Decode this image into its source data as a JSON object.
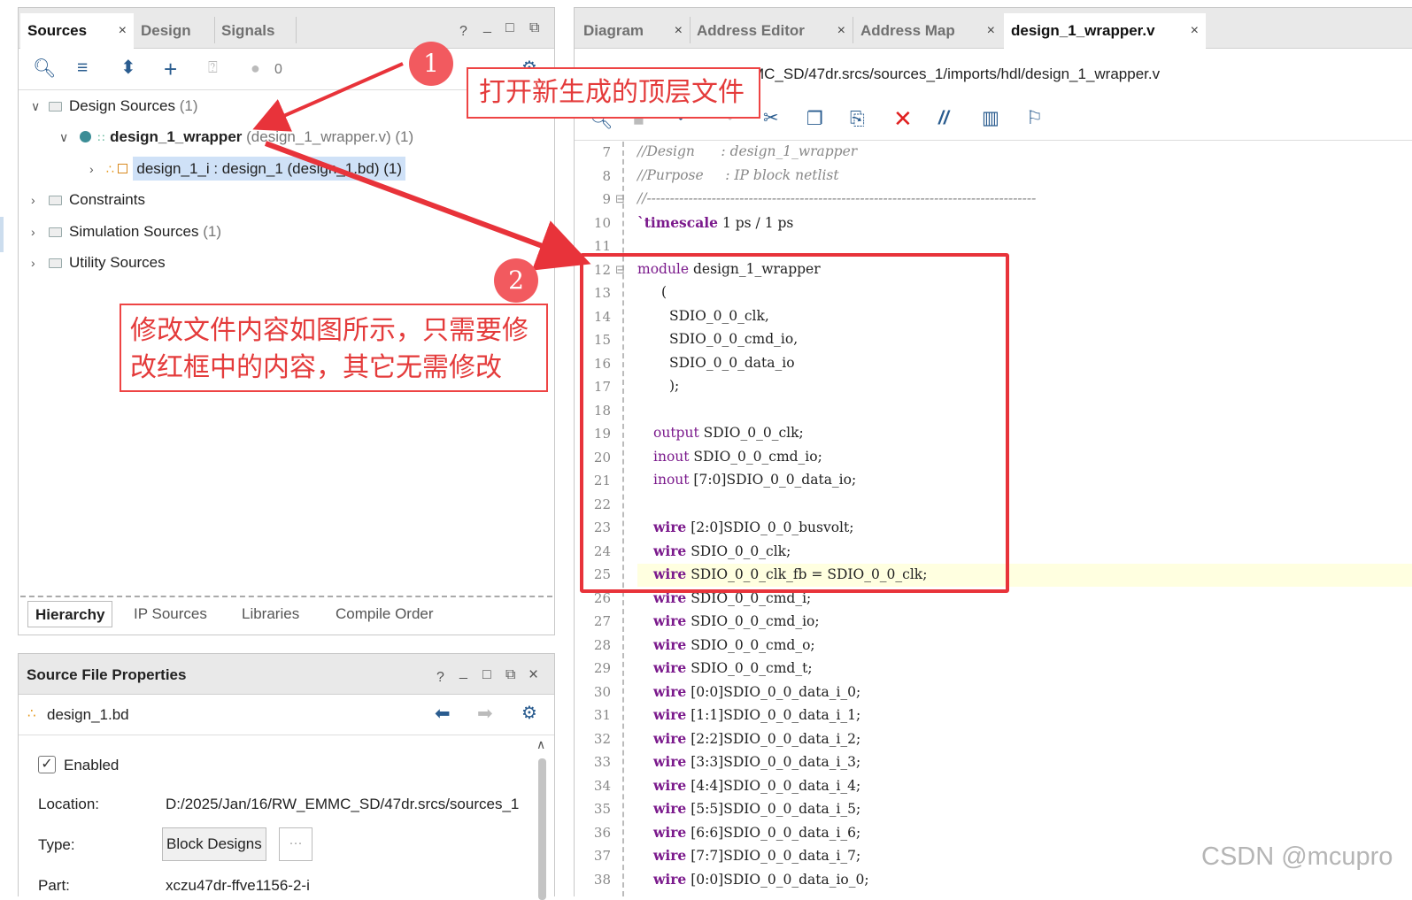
{
  "left_panel": {
    "tabs": [
      {
        "label": "Sources",
        "close": "×"
      },
      {
        "label": "Design"
      },
      {
        "label": "Signals"
      }
    ],
    "window_controls": [
      "?",
      "_",
      "□",
      "⧉"
    ],
    "toolbar_count": "0",
    "tree": {
      "design_sources": {
        "label": "Design Sources",
        "count": "(1)"
      },
      "wrapper": {
        "label": "design_1_wrapper",
        "detail": "(design_1_wrapper.v) (1)"
      },
      "instance": {
        "label": "design_1_i : design_1 (design_1.bd) (1)"
      },
      "constraints": {
        "label": "Constraints"
      },
      "simulation": {
        "label": "Simulation Sources",
        "count": "(1)"
      },
      "utility": {
        "label": "Utility Sources"
      }
    },
    "bottom_tabs": [
      "Hierarchy",
      "IP Sources",
      "Libraries",
      "Compile Order"
    ]
  },
  "properties_panel": {
    "title": "Source File Properties",
    "window_controls": [
      "?",
      "_",
      "□",
      "⧉",
      "×"
    ],
    "file_name": "design_1.bd",
    "enabled_label": "Enabled",
    "location_label": "Location:",
    "location_value": "D:/2025/Jan/16/RW_EMMC_SD/47dr.srcs/sources_1",
    "type_label": "Type:",
    "type_value": "Block Designs",
    "type_more": "···",
    "part_label": "Part:",
    "part_value": "xczu47dr-ffve1156-2-i"
  },
  "editor": {
    "tabs": [
      {
        "label": "Diagram",
        "close": "×"
      },
      {
        "label": "Address Editor",
        "close": "×"
      },
      {
        "label": "Address Map",
        "close": "×"
      },
      {
        "label": "design_1_wrapper.v",
        "close": "×"
      }
    ],
    "path": "D:/2025/Jan/16/RW_EMMC_SD/47dr.srcs/sources_1/imports/hdl/design_1_wrapper.v",
    "lines": [
      {
        "n": "7",
        "text": "//Design      : design_1_wrapper",
        "style": "cm",
        "indent": 0
      },
      {
        "n": "8",
        "text": "//Purpose     : IP block netlist",
        "style": "cm",
        "indent": 0
      },
      {
        "n": "9",
        "text": "//------------------------------------------------------------------------------------",
        "style": "cm",
        "indent": 0
      },
      {
        "n": "10",
        "kw": "`timescale",
        "text": " 1 ps / 1 ps",
        "style": "kwb",
        "indent": 0
      },
      {
        "n": "11",
        "text": "",
        "style": "",
        "indent": 0
      },
      {
        "n": "12",
        "kw": "module",
        "text": " design_1_wrapper",
        "style": "kw",
        "indent": 0
      },
      {
        "n": "13",
        "text": "(",
        "style": "",
        "indent": 3
      },
      {
        "n": "14",
        "text": "SDIO_0_0_clk,",
        "style": "",
        "indent": 4
      },
      {
        "n": "15",
        "text": "SDIO_0_0_cmd_io,",
        "style": "",
        "indent": 4
      },
      {
        "n": "16",
        "text": "SDIO_0_0_data_io",
        "style": "",
        "indent": 4
      },
      {
        "n": "17",
        "text": ");",
        "style": "",
        "indent": 4
      },
      {
        "n": "18",
        "text": "",
        "style": "",
        "indent": 0
      },
      {
        "n": "19",
        "kw": "output",
        "text": " SDIO_0_0_clk;",
        "style": "kw",
        "indent": 2
      },
      {
        "n": "20",
        "kw": "inout",
        "text": " SDIO_0_0_cmd_io;",
        "style": "kw",
        "indent": 2
      },
      {
        "n": "21",
        "kw": "inout",
        "text": " [7:0]SDIO_0_0_data_io;",
        "style": "kw",
        "indent": 2
      },
      {
        "n": "22",
        "text": "",
        "style": "",
        "indent": 0
      },
      {
        "n": "23",
        "kw": "wire",
        "text": " [2:0]SDIO_0_0_busvolt;",
        "style": "kwb",
        "indent": 2
      },
      {
        "n": "24",
        "kw": "wire",
        "text": " SDIO_0_0_clk;",
        "style": "kwb",
        "indent": 2
      },
      {
        "n": "25",
        "kw": "wire",
        "text": " SDIO_0_0_clk_fb = SDIO_0_0_clk;",
        "style": "kwb",
        "indent": 2
      },
      {
        "n": "26",
        "kw": "wire",
        "text": " SDIO_0_0_cmd_i;",
        "style": "kwb",
        "indent": 2
      },
      {
        "n": "27",
        "kw": "wire",
        "text": " SDIO_0_0_cmd_io;",
        "style": "kwb",
        "indent": 2
      },
      {
        "n": "28",
        "kw": "wire",
        "text": " SDIO_0_0_cmd_o;",
        "style": "kwb",
        "indent": 2
      },
      {
        "n": "29",
        "kw": "wire",
        "text": " SDIO_0_0_cmd_t;",
        "style": "kwb",
        "indent": 2
      },
      {
        "n": "30",
        "kw": "wire",
        "text": " [0:0]SDIO_0_0_data_i_0;",
        "style": "kwb",
        "indent": 2
      },
      {
        "n": "31",
        "kw": "wire",
        "text": " [1:1]SDIO_0_0_data_i_1;",
        "style": "kwb",
        "indent": 2
      },
      {
        "n": "32",
        "kw": "wire",
        "text": " [2:2]SDIO_0_0_data_i_2;",
        "style": "kwb",
        "indent": 2
      },
      {
        "n": "33",
        "kw": "wire",
        "text": " [3:3]SDIO_0_0_data_i_3;",
        "style": "kwb",
        "indent": 2
      },
      {
        "n": "34",
        "kw": "wire",
        "text": " [4:4]SDIO_0_0_data_i_4;",
        "style": "kwb",
        "indent": 2
      },
      {
        "n": "35",
        "kw": "wire",
        "text": " [5:5]SDIO_0_0_data_i_5;",
        "style": "kwb",
        "indent": 2
      },
      {
        "n": "36",
        "kw": "wire",
        "text": " [6:6]SDIO_0_0_data_i_6;",
        "style": "kwb",
        "indent": 2
      },
      {
        "n": "37",
        "kw": "wire",
        "text": " [7:7]SDIO_0_0_data_i_7;",
        "style": "kwb",
        "indent": 2
      },
      {
        "n": "38",
        "kw": "wire",
        "text": " [0:0]SDIO_0_0_data_io_0;",
        "style": "kwb",
        "indent": 2
      }
    ]
  },
  "annotations": {
    "badge1": "1",
    "badge2": "2",
    "note1": "打开新生成的顶层文件",
    "note2": "修改文件内容如图所示，只需要修改红框中的内容，其它无需修改",
    "note2_line1": "修改文件内容如图所示，只需要修",
    "note2_line2": "改红框中的内容，其它无需修改",
    "color": "#e83c3c"
  },
  "watermark": "CSDN @mcupro"
}
